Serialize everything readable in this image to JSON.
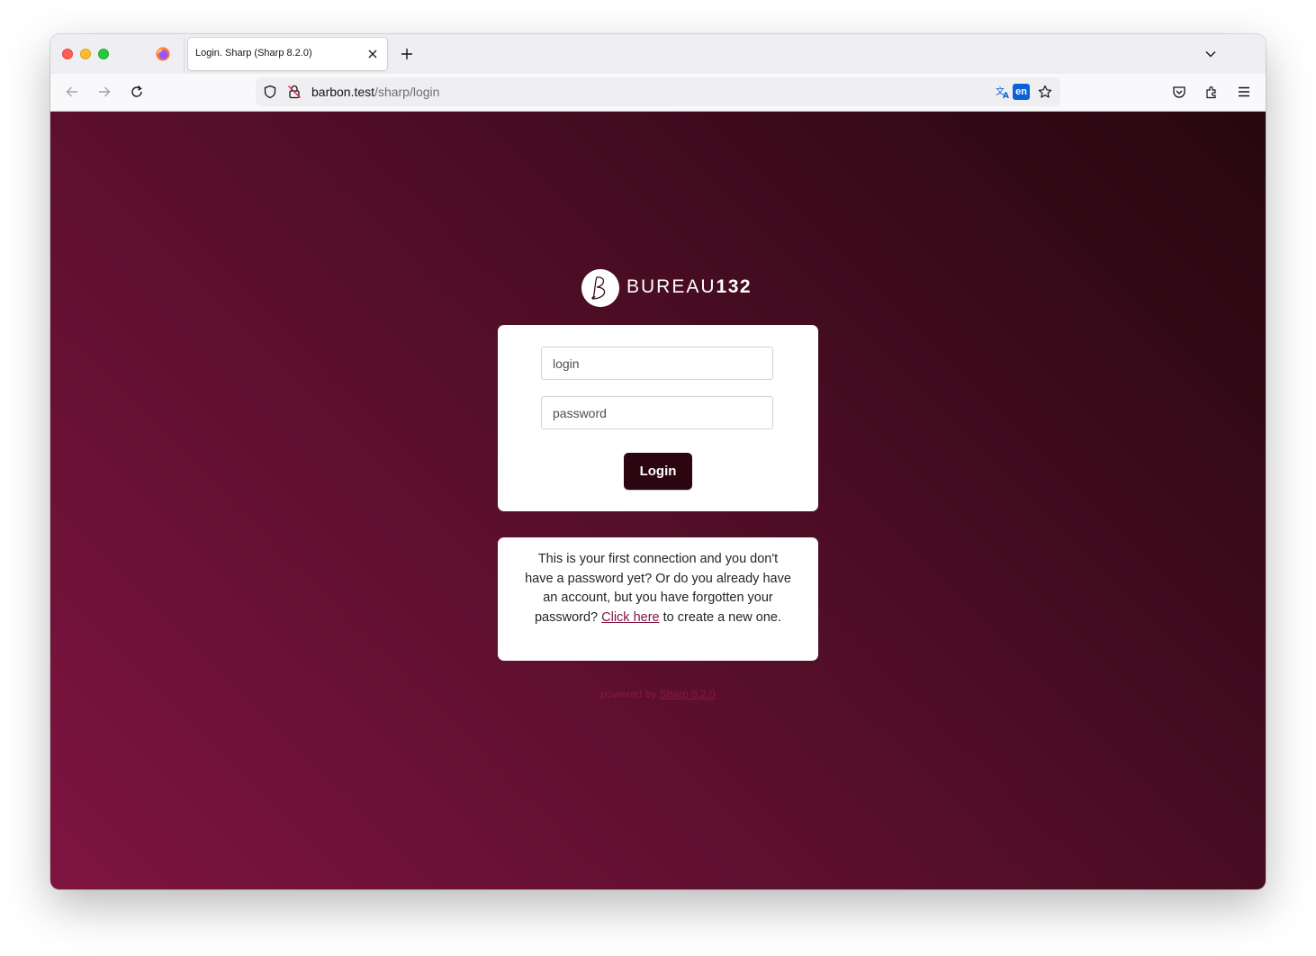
{
  "browser": {
    "tab_title": "Login. Sharp (Sharp 8.2.0)",
    "url_host": "barbon.test",
    "url_path": "/sharp/login",
    "translate_lang": "en"
  },
  "page": {
    "brand_name_light": "BUREAU",
    "brand_name_bold": "132",
    "login_placeholder": "login",
    "password_placeholder": "password",
    "login_button": "Login",
    "info_text_before": "This is your first connection and you don't have a password yet? Or do you already have an account, but you have forgotten your password?",
    "info_link": "Click here",
    "info_text_after": "to create a new one.",
    "powered_by": "powered by",
    "powered_link": "Sharp 8.2.0"
  },
  "colors": {
    "button_bg": "#2b0611",
    "link_color": "#7e1440",
    "gradient_dark": "#27070f",
    "gradient_light": "#7e1440",
    "lang_badge": "#0b62d4"
  }
}
